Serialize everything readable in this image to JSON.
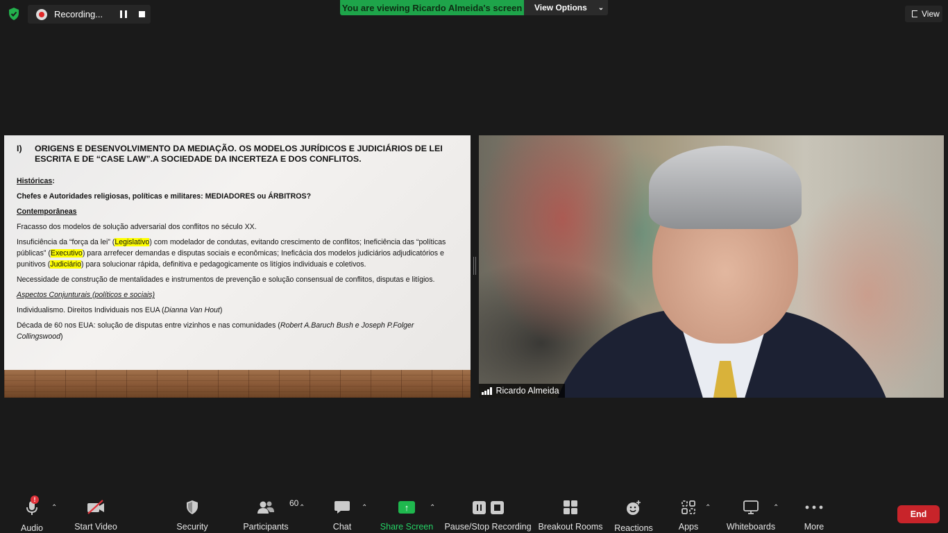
{
  "top": {
    "recording_label": "Recording...",
    "viewing_banner": "You are viewing Ricardo Almeida's screen",
    "view_options_label": "View Options",
    "view_label": "View"
  },
  "slide": {
    "title_num": "I)",
    "title": "ORIGENS E DESENVOLVIMENTO DA MEDIAÇÃO. OS MODELOS JURÍDICOS E JUDICIÁRIOS DE LEI ESCRITA E DE “CASE LAW”.A SOCIEDADE DA INCERTEZA E DOS CONFLITOS.",
    "historicas": "Históricas",
    "chefes": "Chefes e Autoridades religiosas, políticas e militares: MEDIADORES ou ÁRBITROS?",
    "contemporaneas": "Contemporâneas",
    "fracasso": "Fracasso dos modelos de solução adversarial dos conflitos no século XX.",
    "p_ins_1": "Insuficiência da “força da lei” (",
    "legislativo": "Legislativo",
    "p_ins_2": ") com modelador de condutas, evitando crescimento de conflitos; Ineficiência das “políticas públicas” (",
    "executivo": "Executivo",
    "p_ins_3": ") para arrefecer demandas e disputas sociais e econômicas; Ineficácia dos modelos judiciários adjudicatórios e punitivos (",
    "judiciario": "Judiciário",
    "p_ins_4": ") para solucionar rápida, definitiva e pedagogicamente os litígios individuais e coletivos.",
    "necessidade": "Necessidade de construção de mentalidades e instrumentos de prevenção e solução consensual de conflitos, disputas e litígios.",
    "aspectos": "Aspectos Conjunturais (políticos e sociais)",
    "indiv_1": "Individualismo. Direitos Individuais nos EUA (",
    "indiv_name": "Dianna Van Hout",
    "indiv_2": ")",
    "decada_1": "Década de 60 nos EUA: solução de disputas entre vizinhos e nas comunidades (",
    "decada_names": "Robert A.Baruch Bush e Joseph P.Folger Collingswood",
    "decada_2": ")"
  },
  "video": {
    "participant_name": "Ricardo Almeida"
  },
  "toolbar": {
    "audio": "Audio",
    "audio_badge": "!",
    "start_video": "Start Video",
    "security": "Security",
    "participants": "Participants",
    "participants_count": "60",
    "chat": "Chat",
    "share_screen": "Share Screen",
    "pause_stop": "Pause/Stop Recording",
    "breakout": "Breakout Rooms",
    "reactions": "Reactions",
    "apps": "Apps",
    "whiteboards": "Whiteboards",
    "more": "More",
    "end": "End"
  },
  "colors": {
    "banner_green": "#1ea44a",
    "end_red": "#c8242a",
    "highlight": "#ffff00",
    "share_green": "#25d366"
  }
}
